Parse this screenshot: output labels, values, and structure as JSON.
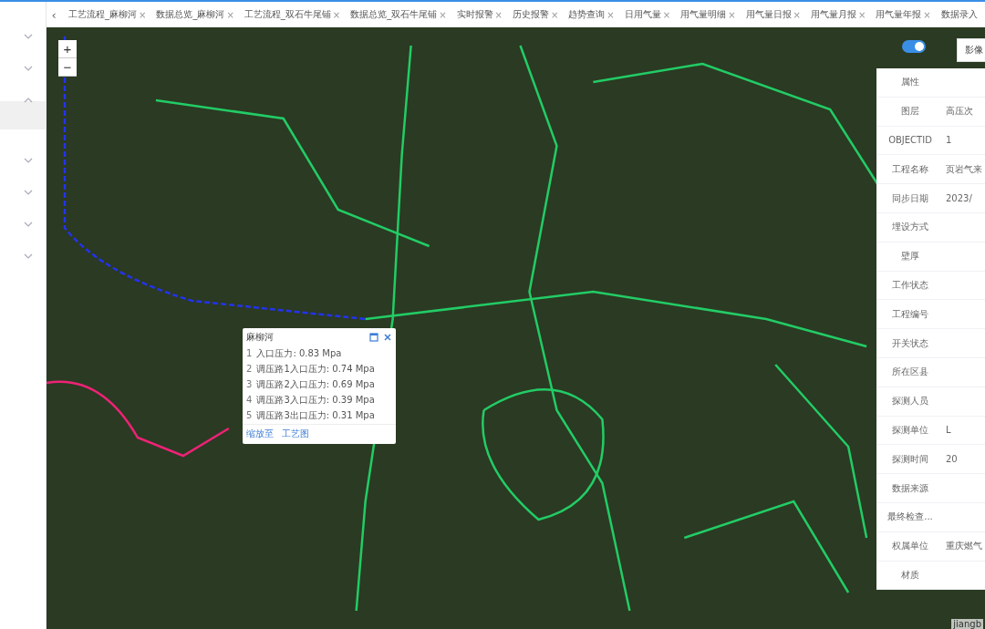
{
  "sidebar": {
    "groups": [
      {
        "expanded": false
      },
      {
        "expanded": false
      },
      {
        "expanded": true,
        "children": [
          {
            "selected": true
          }
        ]
      },
      {
        "expanded": false
      },
      {
        "expanded": false
      },
      {
        "expanded": false
      },
      {
        "expanded": false
      }
    ]
  },
  "tabs": {
    "scroll_left": "‹",
    "items": [
      {
        "label": "工艺流程_麻柳河",
        "close": "×"
      },
      {
        "label": "数据总览_麻柳河",
        "close": "×"
      },
      {
        "label": "工艺流程_双石牛尾铺",
        "close": "×"
      },
      {
        "label": "数据总览_双石牛尾铺",
        "close": "×"
      },
      {
        "label": "实时报警",
        "close": "×"
      },
      {
        "label": "历史报警",
        "close": "×"
      },
      {
        "label": "趋势查询",
        "close": "×"
      },
      {
        "label": "日用气量",
        "close": "×"
      },
      {
        "label": "用气量明细",
        "close": "×"
      },
      {
        "label": "用气量日报",
        "close": "×"
      },
      {
        "label": "用气量月报",
        "close": "×"
      },
      {
        "label": "用气量年报",
        "close": "×"
      },
      {
        "label": "数据录入"
      }
    ]
  },
  "map": {
    "zoom_in": "+",
    "zoom_out": "−",
    "layer_toggle": {
      "on": true
    },
    "basemap_button": "影像",
    "attribution": "jiangb",
    "popup": {
      "title": "麻柳河",
      "items": [
        {
          "index": "1",
          "text": "入口压力: 0.83 Mpa"
        },
        {
          "index": "2",
          "text": "调压路1入口压力: 0.74 Mpa"
        },
        {
          "index": "3",
          "text": "调压路2入口压力: 0.69 Mpa"
        },
        {
          "index": "4",
          "text": "调压路3入口压力: 0.39 Mpa"
        },
        {
          "index": "5",
          "text": "调压路3出口压力: 0.31 Mpa"
        }
      ],
      "links": [
        "缩放至",
        "工艺图"
      ]
    },
    "properties": [
      {
        "label": "属性"
      },
      {
        "label": "图层",
        "value": "高压次"
      },
      {
        "label": "OBJECTID",
        "value": "1"
      },
      {
        "label": "工程名称",
        "value": "页岩气来"
      },
      {
        "label": "同步日期",
        "value": "2023/"
      },
      {
        "label": "埋设方式"
      },
      {
        "label": "壁厚"
      },
      {
        "label": "工作状态"
      },
      {
        "label": "工程编号"
      },
      {
        "label": "开关状态"
      },
      {
        "label": "所在区县"
      },
      {
        "label": "探测人员"
      },
      {
        "label": "探测单位",
        "value": "L"
      },
      {
        "label": "探测时间",
        "value": "20"
      },
      {
        "label": "数据来源"
      },
      {
        "label": "最终检查..."
      },
      {
        "label": "权属单位",
        "value": "重庆燃气"
      },
      {
        "label": "材质"
      }
    ]
  }
}
